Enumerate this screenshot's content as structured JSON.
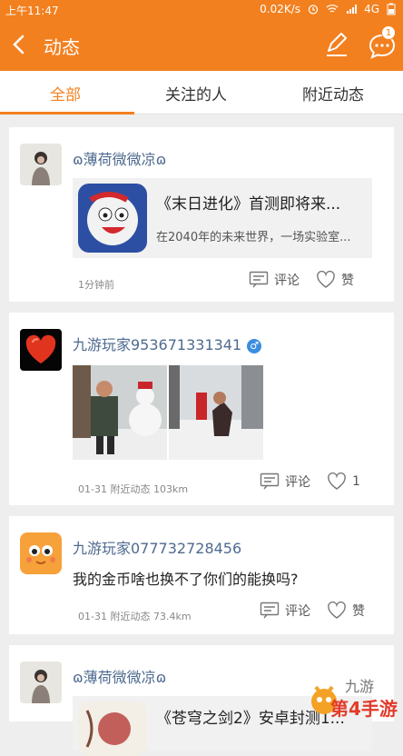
{
  "status": {
    "time": "上午11:47",
    "speed": "0.02K/s",
    "network": "4G"
  },
  "header": {
    "title": "动态",
    "badge_count": "1"
  },
  "tabs": [
    {
      "label": "全部"
    },
    {
      "label": "关注的人"
    },
    {
      "label": "附近动态"
    }
  ],
  "posts": [
    {
      "username": "ɷ薄荷微微凉ɷ",
      "share_title": "《末日进化》首测即将来...",
      "share_desc": "在2040年的未来世界，一场实验室...",
      "time": "1分钟前",
      "comment": "评论",
      "like": "赞"
    },
    {
      "username": "九游玩家953671331341",
      "gender_icon": "♂",
      "time": "01-31",
      "location": "附近动态",
      "distance": "103km",
      "comment": "评论",
      "like": "1"
    },
    {
      "username": "九游玩家077732728456",
      "text": "我的金币啥也换不了你们的能换吗?",
      "time": "01-31",
      "location": "附近动态",
      "distance": "73.4km",
      "comment": "评论",
      "like": "赞"
    },
    {
      "username": "ɷ薄荷微微凉ɷ",
      "share_title": "《苍穹之剑2》安卓封测1..."
    }
  ],
  "watermark": {
    "text": "第4手游",
    "logo_text": "九游"
  },
  "colors": {
    "brand": "#f3801f",
    "username": "#4e6a8f"
  }
}
